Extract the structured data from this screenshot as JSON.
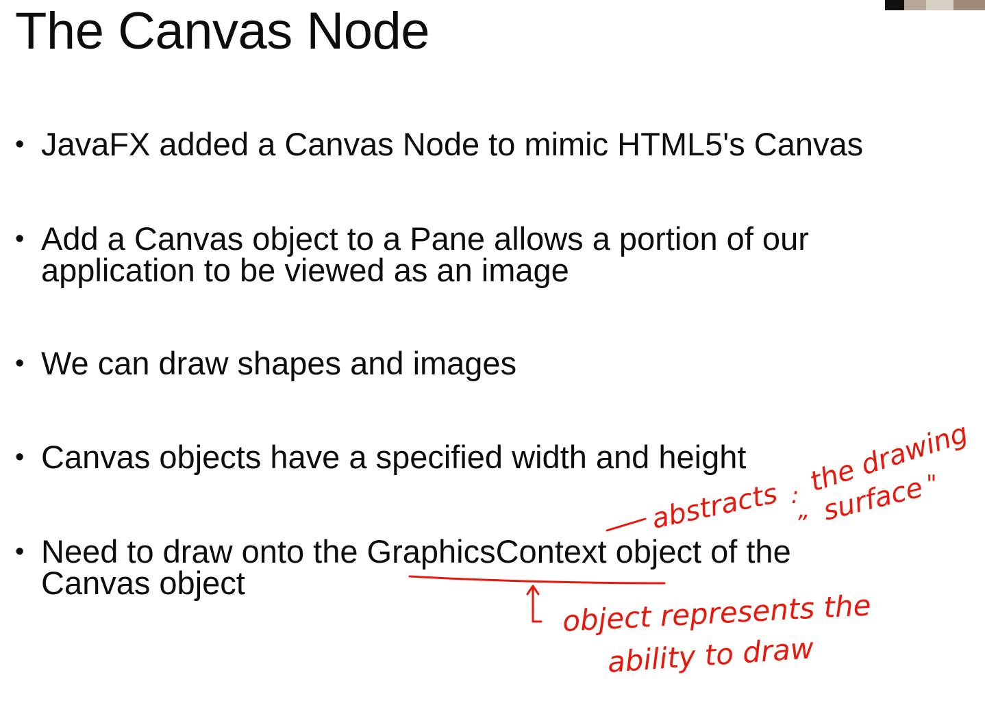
{
  "slide": {
    "title": "The Canvas Node",
    "bullets": [
      {
        "text": "JavaFX added a Canvas Node to mimic HTML5's Canvas"
      },
      {
        "line1": "Add a Canvas object to a Pane allows a portion of our",
        "line2": "application to be viewed as an image"
      },
      {
        "text": "We can draw shapes and images"
      },
      {
        "text": "Canvas objects have a specified width and height"
      },
      {
        "line1_pre": "Need to draw onto the ",
        "line1_highlight": "GraphicsContext",
        "line1_post": " object of the",
        "line2": "Canvas object"
      }
    ],
    "bullet_glyph": "•"
  },
  "annotations": {
    "ink_color": "#e8180c",
    "note1": {
      "word1": "abstracts",
      "word2": "the drawing",
      "word3": "surface"
    },
    "note2": {
      "line1": "object represents the",
      "line2": "ability to draw"
    }
  }
}
